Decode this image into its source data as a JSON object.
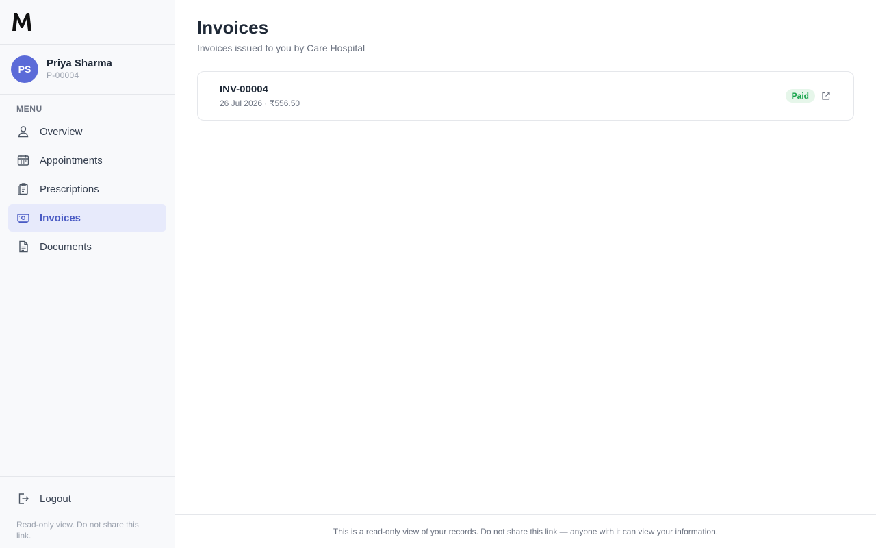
{
  "app": {
    "logo_icon": "m-logo-icon",
    "accent_color": "#5b6bd8"
  },
  "profile": {
    "initials": "PS",
    "name": "Priya Sharma",
    "patient_id": "P-00004"
  },
  "sidebar": {
    "menu_label": "MENU",
    "items": [
      {
        "label": "Overview",
        "icon": "user-icon",
        "active": false
      },
      {
        "label": "Appointments",
        "icon": "calendar-icon",
        "active": false
      },
      {
        "label": "Prescriptions",
        "icon": "clipboard-icon",
        "active": false
      },
      {
        "label": "Invoices",
        "icon": "money-icon",
        "active": true
      },
      {
        "label": "Documents",
        "icon": "document-icon",
        "active": false
      }
    ],
    "logout_label": "Logout",
    "note": "Read-only view. Do not share this link."
  },
  "main": {
    "title": "Invoices",
    "subtitle": "Invoices issued to you by Care Hospital",
    "invoices": [
      {
        "number": "INV-00004",
        "date": "26 Jul 2026",
        "separator": " · ",
        "amount": "₹556.50",
        "status": "Paid",
        "status_color": "#16a34a"
      }
    ]
  },
  "footer": {
    "text": "This is a read-only view of your records. Do not share this link — anyone with it can view your information."
  }
}
